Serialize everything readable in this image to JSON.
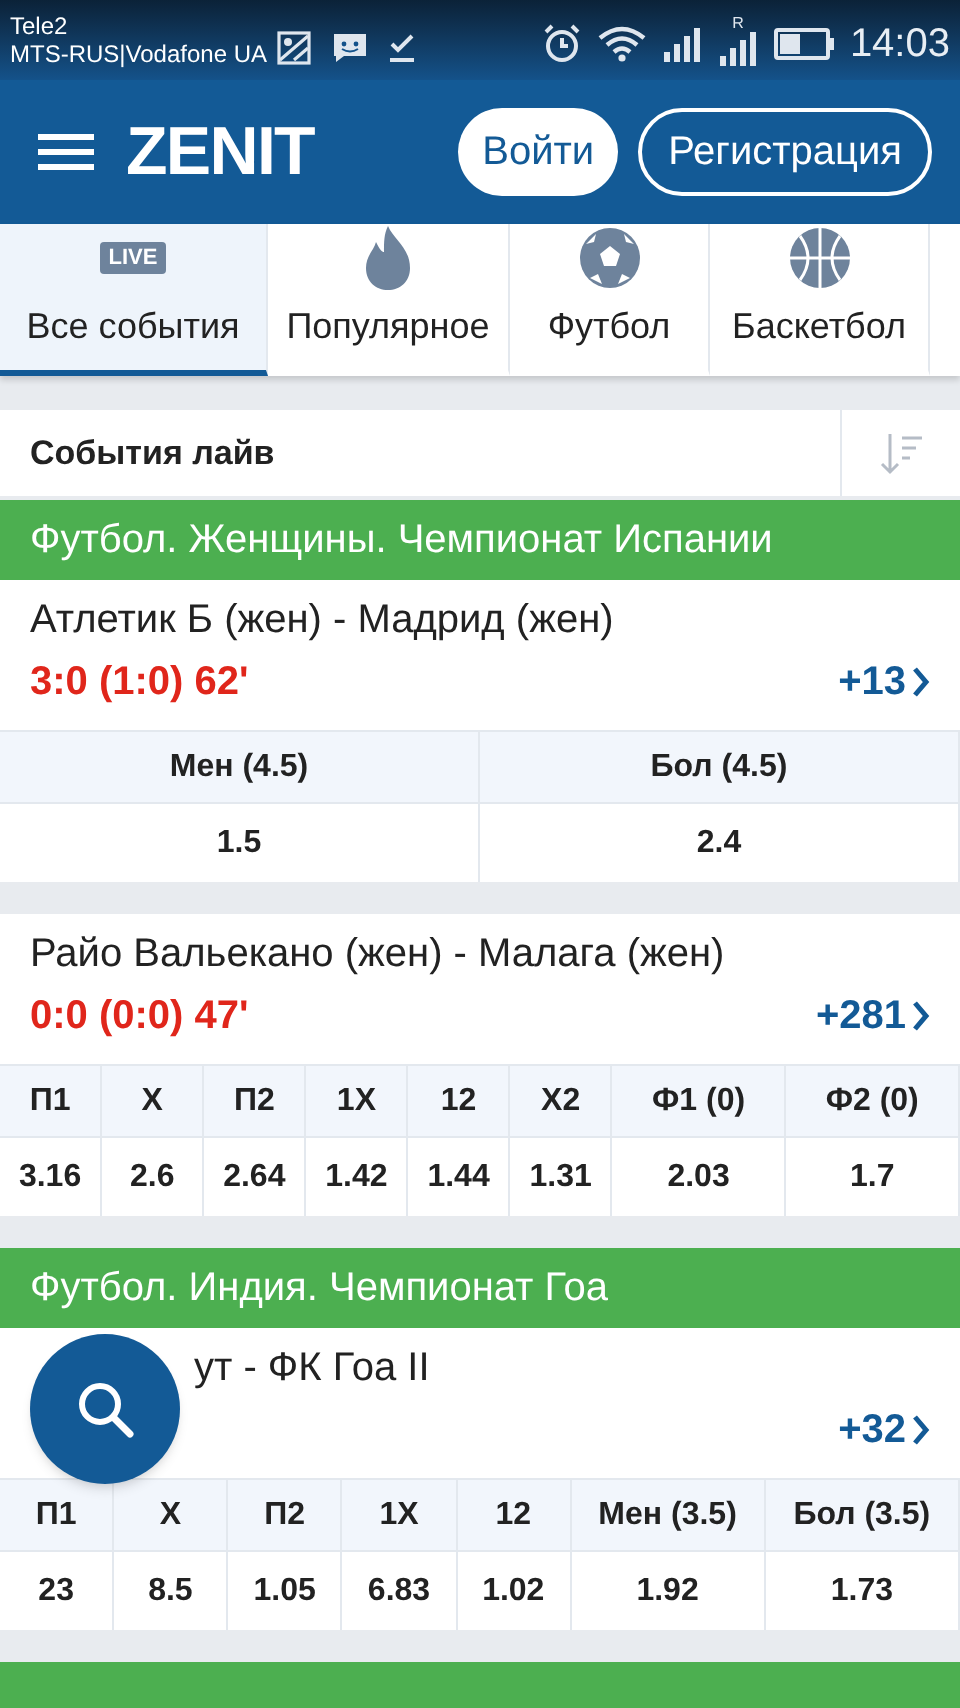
{
  "status_bar": {
    "carrier_1": "Tele2",
    "carrier_2": "MTS-RUS|Vodafone UA",
    "roaming_mark": "R",
    "time": "14:03"
  },
  "header": {
    "logo": "ZENIT",
    "login_button": "Войти",
    "register_button": "Регистрация"
  },
  "tabs": [
    {
      "label": "Все события",
      "kind": "live",
      "icon_text": "LIVE",
      "selected": true
    },
    {
      "label": "Популярное",
      "kind": "popular",
      "selected": false
    },
    {
      "label": "Футбол",
      "kind": "football",
      "selected": false
    },
    {
      "label": "Баскетбол",
      "kind": "basketball",
      "selected": false
    }
  ],
  "section_title": "События лайв",
  "leagues": [
    {
      "title": "Футбол. Женщины. Чемпионат Испании",
      "events": [
        {
          "name_parts": [
            "Атлетик Б (жен) - Мадрид (жен)"
          ],
          "score": "3:0 (1:0) 62'",
          "more": "+13",
          "odds": [
            {
              "label": "Мен (4.5)",
              "value": "1.5"
            },
            {
              "label": "Бол (4.5)",
              "value": "2.4"
            }
          ]
        }
      ]
    },
    {
      "events": [
        {
          "name_parts": [
            "Райо Вальекано (жен) - Малага (жен)"
          ],
          "score": "0:0 (0:0) 47'",
          "more": "+281",
          "odds": [
            {
              "label": "П1",
              "value": "3.16"
            },
            {
              "label": "X",
              "value": "2.6"
            },
            {
              "label": "П2",
              "value": "2.64"
            },
            {
              "label": "1X",
              "value": "1.42"
            },
            {
              "label": "12",
              "value": "1.44"
            },
            {
              "label": "X2",
              "value": "1.31"
            },
            {
              "label": "Ф1 (0)",
              "value": "2.03"
            },
            {
              "label": "Ф2 (0)",
              "value": "1.7"
            }
          ]
        }
      ]
    },
    {
      "title": "Футбол. Индия. Чемпионат Гоа",
      "events": [
        {
          "name_parts": [
            "ут - ФК Гоа II"
          ],
          "name_offset": true,
          "more": "+32",
          "odds": [
            {
              "label": "П1",
              "value": "23"
            },
            {
              "label": "X",
              "value": "8.5"
            },
            {
              "label": "П2",
              "value": "1.05"
            },
            {
              "label": "1X",
              "value": "6.83"
            },
            {
              "label": "12",
              "value": "1.02"
            },
            {
              "label": "Мен (3.5)",
              "value": "1.92"
            },
            {
              "label": "Бол (3.5)",
              "value": "1.73"
            }
          ]
        }
      ]
    },
    {
      "kind": "cut_off"
    }
  ]
}
